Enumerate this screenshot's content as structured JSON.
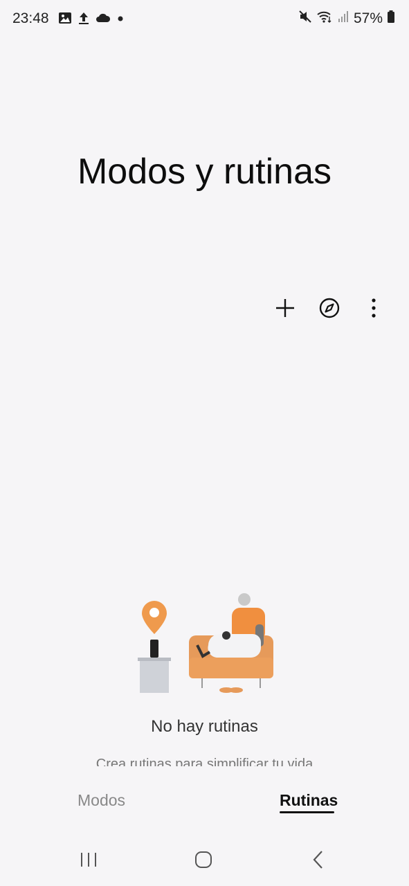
{
  "status_bar": {
    "time": "23:48",
    "battery": "57%",
    "left_icons": [
      "gallery-icon",
      "upload-icon",
      "cloud-icon",
      "dot-icon"
    ],
    "right_icons": [
      "mute-icon",
      "wifi-icon",
      "signal-icon",
      "battery-icon"
    ]
  },
  "header": {
    "title": "Modos y rutinas"
  },
  "toolbar": {
    "icons": [
      "add-icon",
      "compass-icon",
      "more-options-icon"
    ]
  },
  "empty_state": {
    "title": "No hay rutinas",
    "subtitle": "Crea rutinas para simplificar tu vida"
  },
  "tabs": [
    {
      "label": "Modos",
      "selected": false
    },
    {
      "label": "Rutinas",
      "selected": true
    }
  ],
  "colors": {
    "background": "#f6f5f7",
    "accent_orange": "#f2994a",
    "text": "#111111"
  },
  "nav_bar": {
    "icons": [
      "recent-apps-icon",
      "home-icon",
      "back-icon"
    ]
  }
}
